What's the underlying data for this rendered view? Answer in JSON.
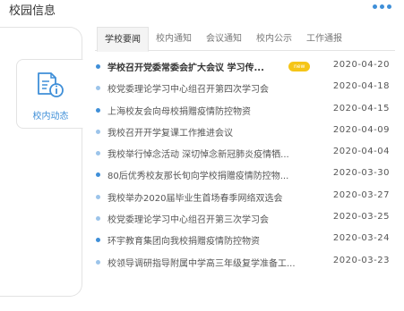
{
  "header": {
    "title": "校园信息"
  },
  "sidebar": {
    "active_label": "校内动态"
  },
  "tabs": [
    {
      "label": "学校要闻"
    },
    {
      "label": "校内通知"
    },
    {
      "label": "会议通知"
    },
    {
      "label": "校内公示"
    },
    {
      "label": "工作通报"
    }
  ],
  "news": [
    {
      "title": "学校召开党委常委会扩大会议 学习传...",
      "date": "2020-04-20",
      "badge": "new"
    },
    {
      "title": "校党委理论学习中心组召开第四次学习会",
      "date": "2020-04-18"
    },
    {
      "title": "上海校友会向母校捐赠疫情防控物资",
      "date": "2020-04-15"
    },
    {
      "title": "我校召开开学复课工作推进会议",
      "date": "2020-04-09"
    },
    {
      "title": "我校举行悼念活动 深切悼念新冠肺炎疫情牺...",
      "date": "2020-04-04"
    },
    {
      "title": "80后优秀校友那长旬向学校捐赠疫情防控物...",
      "date": "2020-03-30"
    },
    {
      "title": "我校举办2020届毕业生首场春季网络双选会",
      "date": "2020-03-27"
    },
    {
      "title": "校党委理论学习中心组召开第三次学习会",
      "date": "2020-03-25"
    },
    {
      "title": "环宇教育集团向我校捐赠疫情防控物资",
      "date": "2020-03-24"
    },
    {
      "title": "校领导调研指导附属中学高三年级复学准备工...",
      "date": "2020-03-23"
    }
  ],
  "colors": {
    "accent": "#3f8fd8",
    "accent_light": "#9cc4ea",
    "badge": "#f5c518"
  }
}
